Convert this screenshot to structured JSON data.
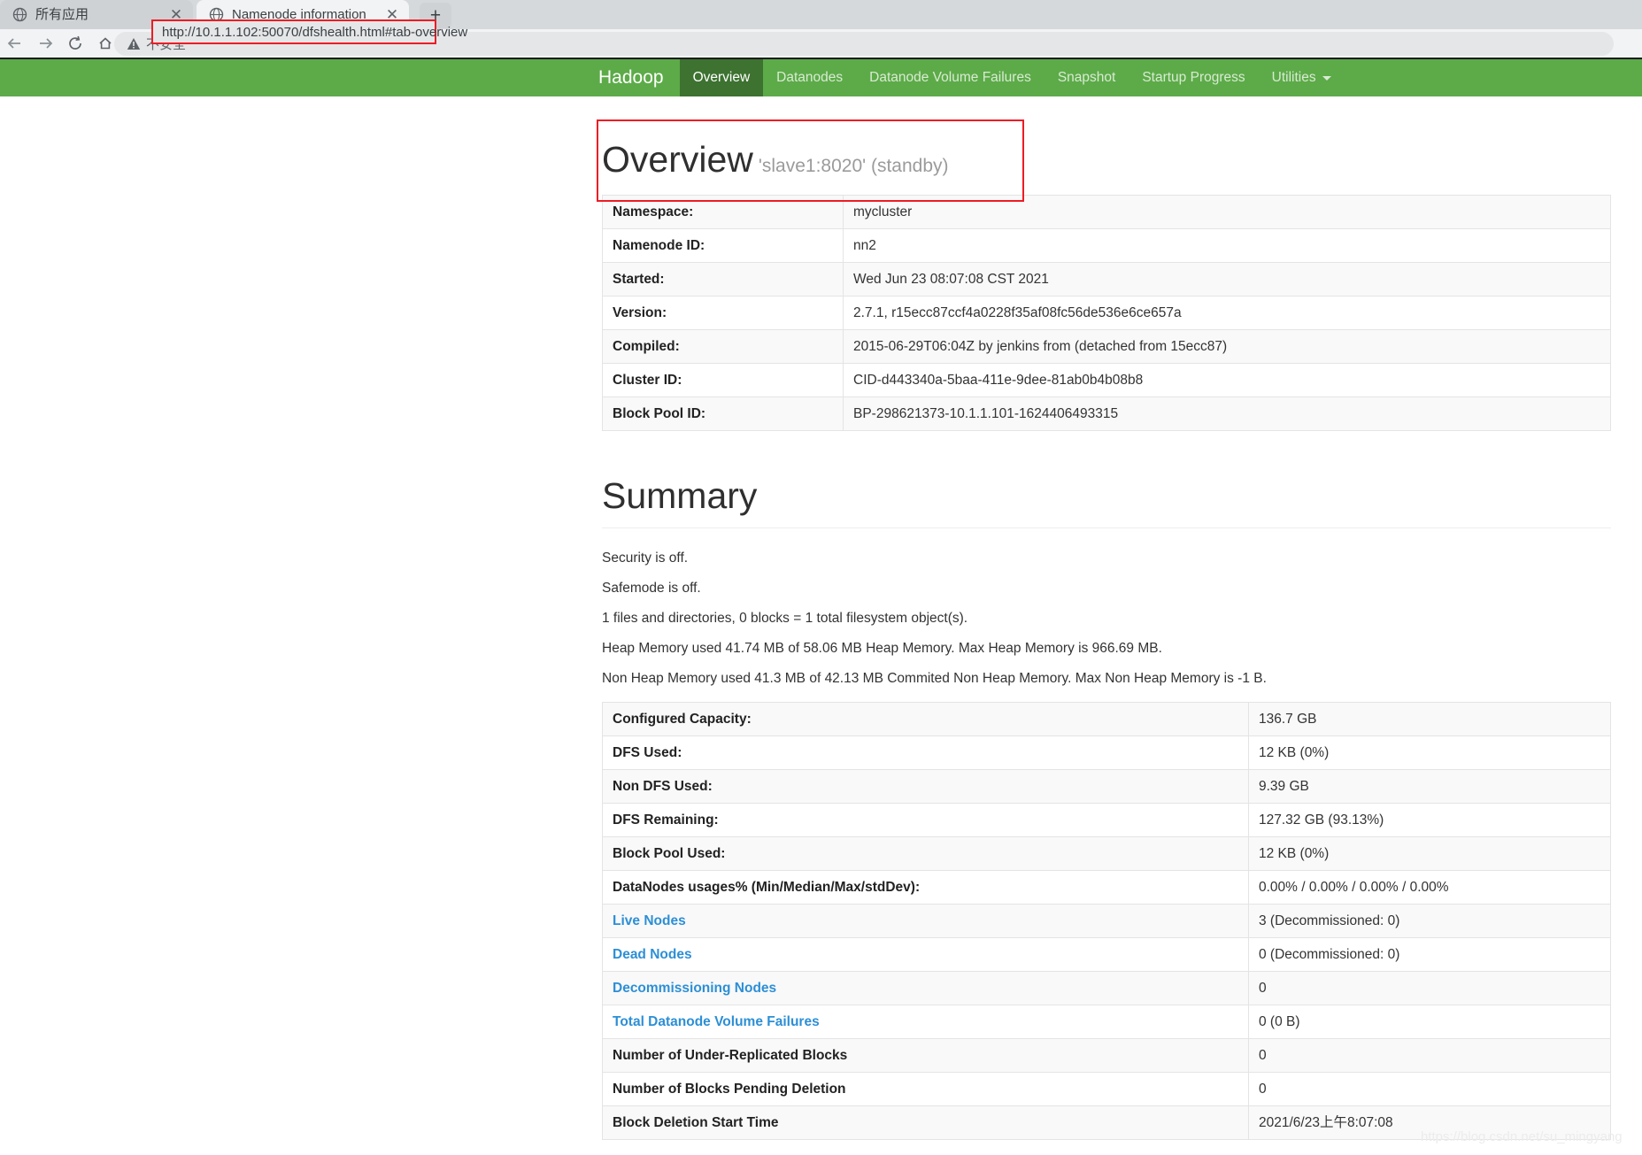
{
  "browser": {
    "tabs": [
      {
        "title": "所有应用",
        "favicon": "globe-icon",
        "close": "✕",
        "active": false
      },
      {
        "title": "Namenode information",
        "favicon": "globe-icon",
        "close": "✕",
        "active": true
      }
    ],
    "new_tab_label": "+",
    "toolbar": {
      "back": "←",
      "forward": "→",
      "reload": "⟳",
      "home": "⌂",
      "security_label": "不安全",
      "url": "http://10.1.1.102:50070/dfshealth.html#tab-overview"
    },
    "highlight_color": "#ed1c24"
  },
  "navbar": {
    "brand": "Hadoop",
    "items": [
      {
        "label": "Overview",
        "active": true
      },
      {
        "label": "Datanodes",
        "active": false
      },
      {
        "label": "Datanode Volume Failures",
        "active": false
      },
      {
        "label": "Snapshot",
        "active": false
      },
      {
        "label": "Startup Progress",
        "active": false
      },
      {
        "label": "Utilities",
        "active": false,
        "caret": true
      }
    ],
    "bg_color": "#5cab48",
    "active_bg_color": "#3d7230"
  },
  "overview": {
    "heading": "Overview",
    "subheading": "'slave1:8020' (standby)",
    "rows": [
      {
        "key": "Namespace:",
        "value": "mycluster"
      },
      {
        "key": "Namenode ID:",
        "value": "nn2"
      },
      {
        "key": "Started:",
        "value": "Wed Jun 23 08:07:08 CST 2021"
      },
      {
        "key": "Version:",
        "value": "2.7.1, r15ecc87ccf4a0228f35af08fc56de536e6ce657a"
      },
      {
        "key": "Compiled:",
        "value": "2015-06-29T06:04Z by jenkins from (detached from 15ecc87)"
      },
      {
        "key": "Cluster ID:",
        "value": "CID-d443340a-5baa-411e-9dee-81ab0b4b08b8"
      },
      {
        "key": "Block Pool ID:",
        "value": "BP-298621373-10.1.1.101-1624406493315"
      }
    ]
  },
  "summary": {
    "heading": "Summary",
    "lines": [
      "Security is off.",
      "Safemode is off.",
      "1 files and directories, 0 blocks = 1 total filesystem object(s).",
      "Heap Memory used 41.74 MB of 58.06 MB Heap Memory. Max Heap Memory is 966.69 MB.",
      "Non Heap Memory used 41.3 MB of 42.13 MB Commited Non Heap Memory. Max Non Heap Memory is -1 B."
    ],
    "rows": [
      {
        "key": "Configured Capacity:",
        "value": "136.7 GB",
        "link": false
      },
      {
        "key": "DFS Used:",
        "value": "12 KB (0%)",
        "link": false
      },
      {
        "key": "Non DFS Used:",
        "value": "9.39 GB",
        "link": false
      },
      {
        "key": "DFS Remaining:",
        "value": "127.32 GB (93.13%)",
        "link": false
      },
      {
        "key": "Block Pool Used:",
        "value": "12 KB (0%)",
        "link": false
      },
      {
        "key": "DataNodes usages% (Min/Median/Max/stdDev):",
        "value": "0.00% / 0.00% / 0.00% / 0.00%",
        "link": false
      },
      {
        "key": "Live Nodes",
        "value": "3 (Decommissioned: 0)",
        "link": true
      },
      {
        "key": "Dead Nodes",
        "value": "0 (Decommissioned: 0)",
        "link": true
      },
      {
        "key": "Decommissioning Nodes",
        "value": "0",
        "link": true
      },
      {
        "key": "Total Datanode Volume Failures",
        "value": "0 (0 B)",
        "link": true
      },
      {
        "key": "Number of Under-Replicated Blocks",
        "value": "0",
        "link": false
      },
      {
        "key": "Number of Blocks Pending Deletion",
        "value": "0",
        "link": false
      },
      {
        "key": "Block Deletion Start Time",
        "value": "2021/6/23上午8:07:08",
        "link": false
      }
    ]
  },
  "watermark": "https://blog.csdn.net/su_mingyang"
}
